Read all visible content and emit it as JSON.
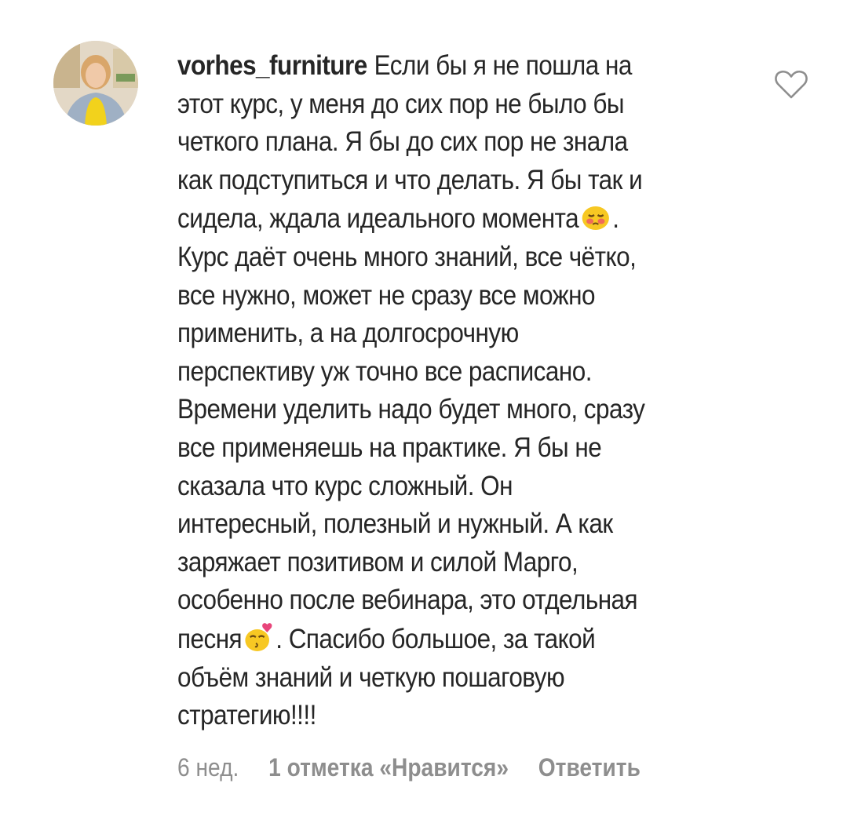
{
  "comment": {
    "username": "vorhes_furniture",
    "lines": [
      "Если бы я не пошла на",
      "этот курс, у меня до сих пор не было бы",
      "четкого плана. Я бы до сих пор не знала",
      "как подступиться и что делать. Я бы так и",
      "сидела, ждала идеального момента",
      "Курс даёт очень много знаний, все чётко,",
      "все нужно, может не сразу все можно",
      "применить, а на долгосрочную",
      "перспективу уж точно все расписано.",
      "Времени уделить надо будет много, сразу",
      "все применяешь на практике. Я бы не",
      "сказала что курс сложный. Он",
      "интересный, полезный и нужный. А как",
      "заряжает позитивом и силой Марго,",
      "особенно после вебинара, это отдельная",
      "песня",
      "объём знаний и четкую пошаговую",
      "стратегию!!!!"
    ],
    "line5_tail": ".",
    "line16_tail": ". Спасибо большое, за такой",
    "emoji_1": "sad-face-emoji",
    "emoji_2": "kiss-face-emoji"
  },
  "meta": {
    "time": "6 нед.",
    "likes": "1 отметка «Нравится»",
    "reply": "Ответить"
  },
  "icons": {
    "like": "heart-icon"
  },
  "colors": {
    "text": "#262626",
    "secondary": "#8e8e8e",
    "emoji_yellow": "#f7c823"
  }
}
